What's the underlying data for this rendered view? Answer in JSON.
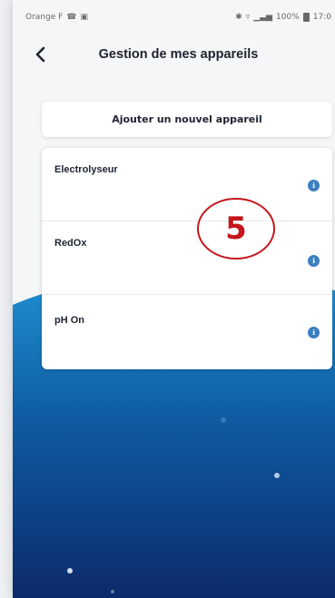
{
  "status_bar": {
    "carrier": "Orange F",
    "right_text": "100%",
    "time": "17:0"
  },
  "header": {
    "title": "Gestion de mes appareils",
    "back_icon": "chevron-left-icon"
  },
  "add_device_button": {
    "label": "Ajouter un nouvel appareil"
  },
  "devices": [
    {
      "name": "Electrolyseur",
      "icon": "info-icon"
    },
    {
      "name": "RedOx",
      "icon": "info-icon"
    },
    {
      "name": "pH On",
      "icon": "info-icon"
    }
  ],
  "annotation": {
    "step_number": "5"
  },
  "colors": {
    "background_top": "#f5f6f8",
    "wave_dark": "#0b2a6b",
    "wave_light": "#1e8fd0",
    "info_icon": "#3b7fc0",
    "badge_red": "#c4161c",
    "text_dark": "#1d2430"
  }
}
